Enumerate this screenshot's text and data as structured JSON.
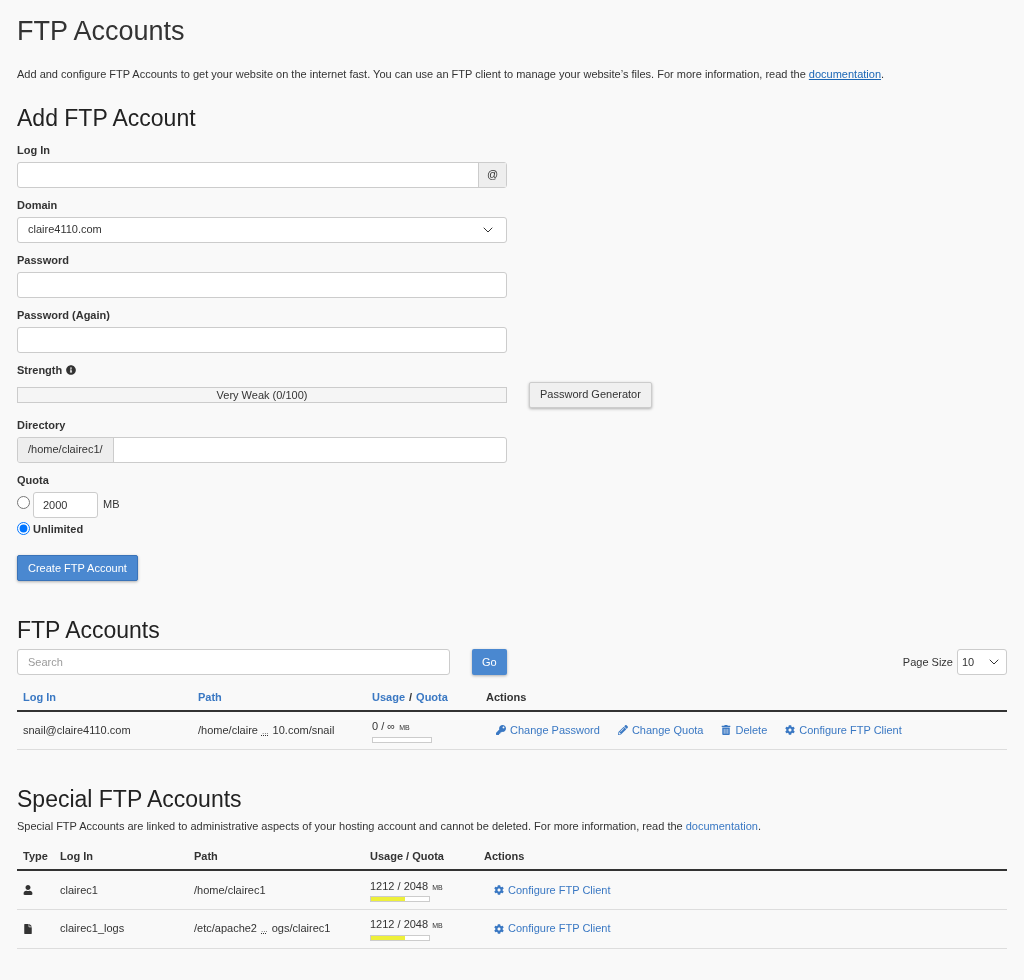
{
  "title": "FTP Accounts",
  "intro": {
    "text": "Add and configure FTP Accounts to get your website on the internet fast. You can use an FTP client to manage your website’s files. For more information, read the ",
    "link": "documentation",
    "after": "."
  },
  "add_form": {
    "title": "Add FTP Account",
    "login": {
      "label": "Log In",
      "suffix": "@"
    },
    "domain": {
      "label": "Domain",
      "value": "claire4110.com"
    },
    "password": {
      "label": "Password"
    },
    "password_again": {
      "label": "Password (Again)"
    },
    "strength": {
      "label": "Strength",
      "meter_text": "Very Weak (0/100)",
      "level": 0
    },
    "generator_button": "Password Generator",
    "directory": {
      "label": "Directory",
      "prefix": "/home/clairec1/"
    },
    "quota": {
      "label": "Quota",
      "options": [
        {
          "kind": "limit",
          "value": "2000",
          "unit": "MB",
          "selected": false
        },
        {
          "kind": "unlimited",
          "label": "Unlimited",
          "selected": true
        }
      ]
    },
    "submit": "Create FTP Account"
  },
  "accounts": {
    "title": "FTP Accounts",
    "search_placeholder": "Search",
    "go": "Go",
    "page_size": {
      "label": "Page Size",
      "value": "10"
    },
    "columns": [
      {
        "kind": "link",
        "label": "Log In"
      },
      {
        "kind": "link",
        "label": "Path"
      },
      {
        "kind": "split",
        "parts": [
          "Usage",
          "Quota"
        ],
        "separator": "/"
      },
      {
        "kind": "plain",
        "label": "Actions"
      }
    ],
    "rows": [
      {
        "login": "snail@claire4110.com",
        "path": {
          "start": "/home/claire",
          "ellipsis": "...",
          "end": "10.com/snail"
        },
        "usage": "0 / ∞",
        "unit": "MB",
        "level": 0,
        "actions": [
          {
            "kind": "key",
            "label": "Change Password"
          },
          {
            "kind": "pencil",
            "label": "Change Quota"
          },
          {
            "kind": "trash",
            "label": "Delete"
          },
          {
            "kind": "gear",
            "label": "Configure FTP Client"
          }
        ]
      }
    ]
  },
  "special": {
    "title": "Special FTP Accounts",
    "description": {
      "text": "Special FTP Accounts are linked to administrative aspects of your hosting account and cannot be deleted. For more information, read the ",
      "link": "documentation",
      "after": "."
    },
    "columns": [
      "Type",
      "Log In",
      "Path",
      "Usage / Quota",
      "Actions"
    ],
    "rows": [
      {
        "kind": "user",
        "login": "clairec1",
        "path": {
          "start": "/home/clairec1"
        },
        "usage": "1212 / 2048",
        "unit": "MB",
        "level": 0.59,
        "actions": [
          {
            "kind": "gear",
            "label": "Configure FTP Client"
          }
        ]
      },
      {
        "kind": "file",
        "login": "clairec1_logs",
        "path": {
          "start": "/etc/apache2",
          "ellipsis": "...",
          "end": "ogs/clairec1"
        },
        "usage": "1212 / 2048",
        "unit": "MB",
        "level": 0.59,
        "actions": [
          {
            "kind": "gear",
            "label": "Configure FTP Client"
          }
        ]
      }
    ]
  }
}
